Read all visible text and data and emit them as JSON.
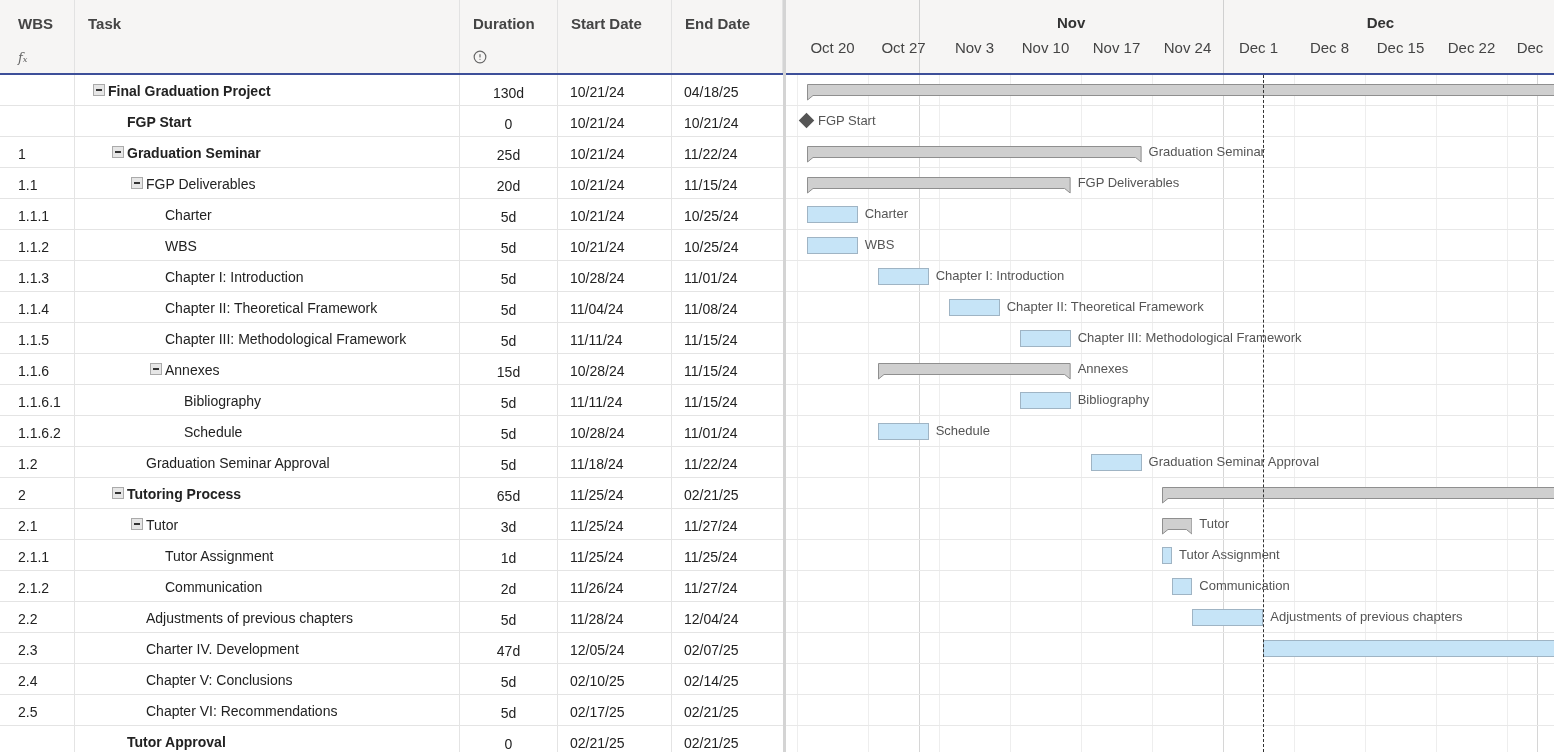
{
  "columns": [
    {
      "label": "WBS",
      "symbol": "𝑓ₓ"
    },
    {
      "label": "Task"
    },
    {
      "label": "Duration",
      "info_icon": true
    },
    {
      "label": "Start Date"
    },
    {
      "label": "End Date"
    }
  ],
  "timeline": {
    "months": [
      {
        "label": "Nov"
      },
      {
        "label": "Dec"
      }
    ],
    "weeks": [
      "Oct 20",
      "Oct 27",
      "Nov 3",
      "Nov 10",
      "Nov 17",
      "Nov 24",
      "Dec 1",
      "Dec 8",
      "Dec 15",
      "Dec 22",
      "Dec"
    ]
  },
  "tasks": [
    {
      "name": "Final Graduation Project",
      "kind": "summary",
      "expanded": true,
      "duration": "130d",
      "start": "10/21/24",
      "end": "04/18/25",
      "children": [
        {
          "name": "FGP Start",
          "kind": "milestone",
          "duration": "0",
          "start": "10/21/24",
          "end": "10/21/24",
          "bar_label": "FGP Start"
        },
        {
          "wbs": "1",
          "name": "Graduation Seminar",
          "kind": "summary",
          "expanded": true,
          "duration": "25d",
          "start": "10/21/24",
          "end": "11/22/24",
          "bar_label": "Graduation Seminar",
          "children": [
            {
              "wbs": "1.1",
              "name": "FGP Deliverables",
              "kind": "group",
              "expanded": true,
              "duration": "20d",
              "start": "10/21/24",
              "end": "11/15/24",
              "bar_label": "FGP Deliverables",
              "children": [
                {
                  "wbs": "1.1.1",
                  "name": "Charter",
                  "kind": "task",
                  "duration": "5d",
                  "start": "10/21/24",
                  "end": "10/25/24",
                  "bar_label": "Charter"
                },
                {
                  "wbs": "1.1.2",
                  "name": "WBS",
                  "kind": "task",
                  "duration": "5d",
                  "start": "10/21/24",
                  "end": "10/25/24",
                  "bar_label": "WBS"
                },
                {
                  "wbs": "1.1.3",
                  "name": "Chapter I: Introduction",
                  "kind": "task",
                  "duration": "5d",
                  "start": "10/28/24",
                  "end": "11/01/24",
                  "bar_label": "Chapter I: Introduction"
                },
                {
                  "wbs": "1.1.4",
                  "name": "Chapter II: Theoretical Framework",
                  "kind": "task",
                  "duration": "5d",
                  "start": "11/04/24",
                  "end": "11/08/24",
                  "bar_label": "Chapter II: Theoretical Framework"
                },
                {
                  "wbs": "1.1.5",
                  "name": "Chapter III: Methodological Framework",
                  "kind": "task",
                  "duration": "5d",
                  "start": "11/11/24",
                  "end": "11/15/24",
                  "bar_label": "Chapter III: Methodological Framework"
                },
                {
                  "wbs": "1.1.6",
                  "name": "Annexes",
                  "kind": "group",
                  "expanded": true,
                  "duration": "15d",
                  "start": "10/28/24",
                  "end": "11/15/24",
                  "bar_label": "Annexes",
                  "children": [
                    {
                      "wbs": "1.1.6.1",
                      "name": "Bibliography",
                      "kind": "task",
                      "duration": "5d",
                      "start": "11/11/24",
                      "end": "11/15/24",
                      "bar_label": "Bibliography"
                    },
                    {
                      "wbs": "1.1.6.2",
                      "name": "Schedule",
                      "kind": "task",
                      "duration": "5d",
                      "start": "10/28/24",
                      "end": "11/01/24",
                      "bar_label": "Schedule"
                    }
                  ]
                }
              ]
            },
            {
              "wbs": "1.2",
              "name": "Graduation Seminar Approval",
              "kind": "task",
              "duration": "5d",
              "start": "11/18/24",
              "end": "11/22/24",
              "bar_label": "Graduation Seminar Approval"
            }
          ]
        },
        {
          "wbs": "2",
          "name": "Tutoring Process",
          "kind": "summary",
          "expanded": true,
          "duration": "65d",
          "start": "11/25/24",
          "end": "02/21/25",
          "children": [
            {
              "wbs": "2.1",
              "name": "Tutor",
              "kind": "group",
              "expanded": true,
              "duration": "3d",
              "start": "11/25/24",
              "end": "11/27/24",
              "bar_label": "Tutor",
              "children": [
                {
                  "wbs": "2.1.1",
                  "name": "Tutor Assignment",
                  "kind": "task",
                  "duration": "1d",
                  "start": "11/25/24",
                  "end": "11/25/24",
                  "bar_label": "Tutor Assignment"
                },
                {
                  "wbs": "2.1.2",
                  "name": "Communication",
                  "kind": "task",
                  "duration": "2d",
                  "start": "11/26/24",
                  "end": "11/27/24",
                  "bar_label": "Communication"
                }
              ]
            },
            {
              "wbs": "2.2",
              "name": "Adjustments of previous chapters",
              "kind": "task",
              "duration": "5d",
              "start": "11/28/24",
              "end": "12/04/24",
              "bar_label": "Adjustments of previous chapters"
            },
            {
              "wbs": "2.3",
              "name": "Charter IV. Development",
              "kind": "task",
              "duration": "47d",
              "start": "12/05/24",
              "end": "02/07/25"
            },
            {
              "wbs": "2.4",
              "name": "Chapter V: Conclusions",
              "kind": "task",
              "duration": "5d",
              "start": "02/10/25",
              "end": "02/14/25"
            },
            {
              "wbs": "2.5",
              "name": "Chapter VI: Recommendations",
              "kind": "task",
              "duration": "5d",
              "start": "02/17/25",
              "end": "02/21/25"
            }
          ]
        },
        {
          "name": "Tutor Approval",
          "kind": "milestone",
          "duration": "0",
          "start": "02/21/25",
          "end": "02/21/25"
        }
      ]
    }
  ]
}
